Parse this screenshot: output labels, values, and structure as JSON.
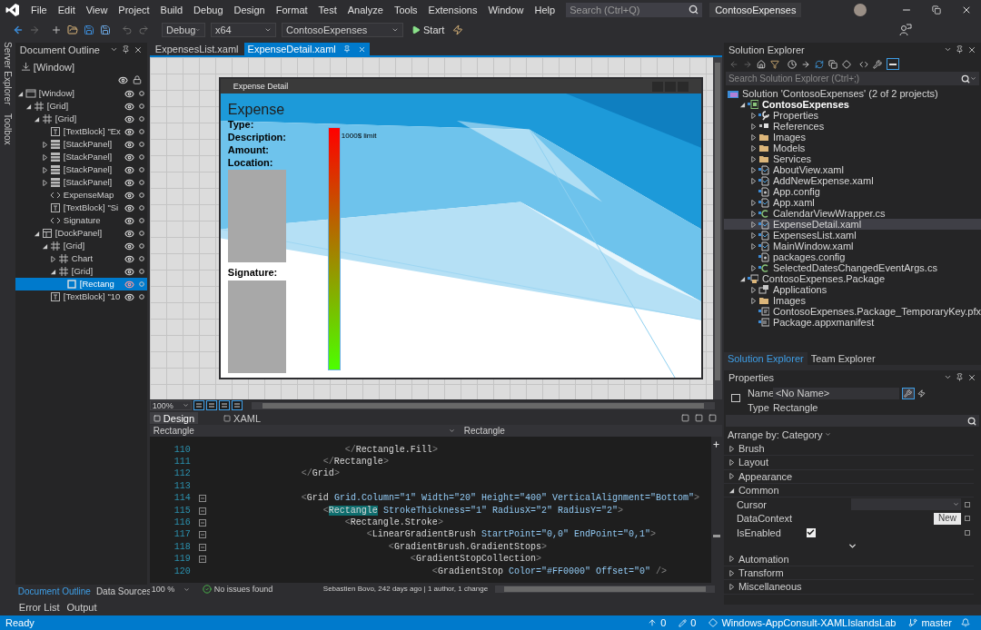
{
  "title_bar": {
    "menu": [
      "File",
      "Edit",
      "View",
      "Project",
      "Build",
      "Debug",
      "Design",
      "Format",
      "Test",
      "Analyze",
      "Tools",
      "Extensions",
      "Window",
      "Help"
    ],
    "search": {
      "placeholder": "Search (Ctrl+Q)"
    },
    "title": "ContosoExpenses"
  },
  "toolbar": {
    "configuration": "Debug",
    "platform": "x64",
    "project": "ContosoExpenses",
    "start": "Start"
  },
  "side_tabs": [
    "Server Explorer",
    "Toolbox"
  ],
  "document_outline": {
    "title": "Document Outline",
    "top": "[Window]",
    "items": [
      {
        "label": "[Window]",
        "kind": "window",
        "expanded": true,
        "selected": false,
        "children": [
          {
            "label": "[Grid]",
            "kind": "grid",
            "expanded": true,
            "selected": false,
            "children": [
              {
                "label": "[Grid]",
                "kind": "grid",
                "expanded": true,
                "selected": false,
                "children": [
                  {
                    "label": "[TextBlock] \"Ex",
                    "kind": "textblock",
                    "selected": false
                  },
                  {
                    "label": "[StackPanel]",
                    "kind": "stackpanel",
                    "expanded": false,
                    "selected": false
                  },
                  {
                    "label": "[StackPanel]",
                    "kind": "stackpanel",
                    "expanded": false,
                    "selected": false
                  },
                  {
                    "label": "[StackPanel]",
                    "kind": "stackpanel",
                    "expanded": false,
                    "selected": false
                  },
                  {
                    "label": "[StackPanel]",
                    "kind": "stackpanel",
                    "expanded": false,
                    "selected": false
                  },
                  {
                    "label": "ExpenseMap",
                    "kind": "control",
                    "selected": false
                  },
                  {
                    "label": "[TextBlock] \"Si",
                    "kind": "textblock",
                    "selected": false
                  },
                  {
                    "label": "Signature",
                    "kind": "control",
                    "selected": false
                  }
                ]
              },
              {
                "label": "[DockPanel]",
                "kind": "dockpanel",
                "expanded": true,
                "selected": false,
                "children": [
                  {
                    "label": "[Grid]",
                    "kind": "grid",
                    "expanded": true,
                    "selected": false,
                    "children": [
                      {
                        "label": "Chart",
                        "kind": "grid",
                        "expanded": false,
                        "selected": false
                      },
                      {
                        "label": "[Grid]",
                        "kind": "grid",
                        "expanded": true,
                        "selected": false,
                        "children": [
                          {
                            "label": "[Rectang",
                            "kind": "rectangle",
                            "selected": true
                          }
                        ]
                      }
                    ]
                  },
                  {
                    "label": "[TextBlock] \"10",
                    "kind": "textblock",
                    "selected": false
                  }
                ]
              }
            ]
          }
        ]
      }
    ]
  },
  "left_bottom_tabs": [
    {
      "label": "Document Outline",
      "selected": true
    },
    {
      "label": "Data Sources",
      "selected": false
    }
  ],
  "output_tabs": [
    "Error List",
    "Output"
  ],
  "editor_tabs": [
    {
      "label": "ExpensesList.xaml",
      "selected": false
    },
    {
      "label": "ExpenseDetail.xaml",
      "selected": true
    }
  ],
  "designer": {
    "window_title": "Expense Detail",
    "heading": "Expense",
    "labels": [
      "Type:",
      "Description:",
      "Amount:",
      "Location:"
    ],
    "signature_label": "Signature:",
    "limit_label": "1000$ limit",
    "zoom": "100%"
  },
  "view_tabs": [
    {
      "label": "Design",
      "selected": true
    },
    {
      "label": "XAML",
      "selected": false
    }
  ],
  "nav_bar": {
    "left": "Rectangle",
    "right": "Rectangle"
  },
  "code": {
    "lines": [
      {
        "number": "110",
        "foldable": false,
        "tokens": [
          {
            "text": "                        </",
            "kind": "punct"
          },
          {
            "text": "Rectangle.Fill",
            "kind": "element"
          },
          {
            "text": ">",
            "kind": "punct"
          }
        ]
      },
      {
        "number": "111",
        "foldable": false,
        "tokens": [
          {
            "text": "                    </",
            "kind": "punct"
          },
          {
            "text": "Rectangle",
            "kind": "element"
          },
          {
            "text": ">",
            "kind": "punct"
          }
        ]
      },
      {
        "number": "112",
        "foldable": false,
        "tokens": [
          {
            "text": "                </",
            "kind": "punct"
          },
          {
            "text": "Grid",
            "kind": "element"
          },
          {
            "text": ">",
            "kind": "punct"
          }
        ]
      },
      {
        "number": "113",
        "foldable": false
      },
      {
        "number": "114",
        "foldable": true,
        "tokens": [
          {
            "text": "                <",
            "kind": "punct"
          },
          {
            "text": "Grid",
            "kind": "element"
          },
          {
            "text": " Grid.Column=",
            "kind": "attr"
          },
          {
            "text": "\"1\"",
            "kind": "value"
          },
          {
            "text": " Width=",
            "kind": "attr"
          },
          {
            "text": "\"20\"",
            "kind": "value"
          },
          {
            "text": " Height=",
            "kind": "attr"
          },
          {
            "text": "\"400\"",
            "kind": "value"
          },
          {
            "text": " VerticalAlignment=",
            "kind": "attr"
          },
          {
            "text": "\"Bottom\"",
            "kind": "value"
          },
          {
            "text": ">",
            "kind": "punct"
          }
        ]
      },
      {
        "number": "115",
        "foldable": true,
        "tokens": [
          {
            "text": "                    <",
            "kind": "punct"
          },
          {
            "text": "Rectangle",
            "kind": "match"
          },
          {
            "text": " StrokeThickness=",
            "kind": "attr"
          },
          {
            "text": "\"1\"",
            "kind": "value"
          },
          {
            "text": " RadiusX=",
            "kind": "attr"
          },
          {
            "text": "\"2\"",
            "kind": "value"
          },
          {
            "text": " RadiusY=",
            "kind": "attr"
          },
          {
            "text": "\"2\"",
            "kind": "value"
          },
          {
            "text": ">",
            "kind": "punct"
          }
        ]
      },
      {
        "number": "116",
        "foldable": true,
        "tokens": [
          {
            "text": "                        <",
            "kind": "punct"
          },
          {
            "text": "Rectangle.Stroke",
            "kind": "element"
          },
          {
            "text": ">",
            "kind": "punct"
          }
        ]
      },
      {
        "number": "117",
        "foldable": true,
        "tokens": [
          {
            "text": "                            <",
            "kind": "punct"
          },
          {
            "text": "LinearGradientBrush",
            "kind": "element"
          },
          {
            "text": " StartPoint=",
            "kind": "attr"
          },
          {
            "text": "\"0,0\"",
            "kind": "value"
          },
          {
            "text": " EndPoint=",
            "kind": "attr"
          },
          {
            "text": "\"0,1\"",
            "kind": "value"
          },
          {
            "text": ">",
            "kind": "punct"
          }
        ]
      },
      {
        "number": "118",
        "foldable": true,
        "tokens": [
          {
            "text": "                                <",
            "kind": "punct"
          },
          {
            "text": "GradientBrush.GradientStops",
            "kind": "element"
          },
          {
            "text": ">",
            "kind": "punct"
          }
        ]
      },
      {
        "number": "119",
        "foldable": true,
        "tokens": [
          {
            "text": "                                    <",
            "kind": "punct"
          },
          {
            "text": "GradientStopCollection",
            "kind": "element"
          },
          {
            "text": ">",
            "kind": "punct"
          }
        ]
      },
      {
        "number": "120",
        "foldable": false,
        "tokens": [
          {
            "text": "                                        <",
            "kind": "punct"
          },
          {
            "text": "GradientStop",
            "kind": "element"
          },
          {
            "text": " Color=",
            "kind": "attr"
          },
          {
            "text": "\"#FF0000\"",
            "kind": "value"
          },
          {
            "text": " Offset=",
            "kind": "attr"
          },
          {
            "text": "\"0\"",
            "kind": "value"
          },
          {
            "text": " />",
            "kind": "punct"
          }
        ]
      }
    ]
  },
  "editor_status": {
    "zoom": "100 %",
    "issues": "No issues found",
    "blame": "Sebastien Bovo, 242 days ago | 1 author, 1 change"
  },
  "solution_explorer": {
    "title": "Solution Explorer",
    "search": {
      "placeholder": "Search Solution Explorer (Ctrl+;)"
    },
    "items": [
      {
        "label": "Solution 'ContosoExpenses' (2 of 2 projects)",
        "kind": "solution",
        "selected": false,
        "children": [
          {
            "label": "ContosoExpenses",
            "kind": "project",
            "expanded": true,
            "selected": false,
            "children": [
              {
                "label": "Properties",
                "kind": "properties",
                "expanded": false,
                "selected": false
              },
              {
                "label": "References",
                "kind": "references",
                "expanded": false,
                "selected": false
              },
              {
                "label": "Images",
                "kind": "folder",
                "expanded": false,
                "selected": false
              },
              {
                "label": "Models",
                "kind": "folder",
                "expanded": false,
                "selected": false
              },
              {
                "label": "Services",
                "kind": "folder",
                "expanded": false,
                "selected": false
              },
              {
                "label": "AboutView.xaml",
                "kind": "xaml",
                "expanded": false,
                "selected": false
              },
              {
                "label": "AddNewExpense.xaml",
                "kind": "xaml",
                "expanded": false,
                "selected": false
              },
              {
                "label": "App.config",
                "kind": "config",
                "selected": false
              },
              {
                "label": "App.xaml",
                "kind": "xaml",
                "expanded": false,
                "selected": false
              },
              {
                "label": "CalendarViewWrapper.cs",
                "kind": "cs",
                "expanded": false,
                "selected": false
              },
              {
                "label": "ExpenseDetail.xaml",
                "kind": "xaml",
                "expanded": false,
                "selected": true
              },
              {
                "label": "ExpensesList.xaml",
                "kind": "xaml",
                "expanded": false,
                "selected": false
              },
              {
                "label": "MainWindow.xaml",
                "kind": "xaml",
                "expanded": false,
                "selected": false
              },
              {
                "label": "packages.config",
                "kind": "config",
                "selected": false
              },
              {
                "label": "SelectedDatesChangedEventArgs.cs",
                "kind": "cs",
                "expanded": false,
                "selected": false
              }
            ]
          },
          {
            "label": "ContosoExpenses.Package",
            "kind": "package",
            "expanded": true,
            "selected": false,
            "children": [
              {
                "label": "Applications",
                "kind": "applications",
                "expanded": false,
                "selected": false
              },
              {
                "label": "Images",
                "kind": "folder",
                "expanded": false,
                "selected": false
              },
              {
                "label": "ContosoExpenses.Package_TemporaryKey.pfx",
                "kind": "pfx",
                "selected": false
              },
              {
                "label": "Package.appxmanifest",
                "kind": "manifest",
                "selected": false
              }
            ]
          }
        ]
      }
    ]
  },
  "right_tabs": [
    {
      "label": "Solution Explorer",
      "selected": true
    },
    {
      "label": "Team Explorer",
      "selected": false
    }
  ],
  "properties": {
    "title": "Properties",
    "name_label": "Name",
    "name_value": "<No Name>",
    "type_label": "Type",
    "type_value": "Rectangle",
    "arrange": "Arrange by: Category",
    "categories": [
      {
        "label": "Brush",
        "expanded": false
      },
      {
        "label": "Layout",
        "expanded": false
      },
      {
        "label": "Appearance",
        "expanded": false
      },
      {
        "label": "Common",
        "expanded": true,
        "properties": [
          {
            "label": "Cursor",
            "kind": "dropdown"
          },
          {
            "label": "DataContext",
            "kind": "button",
            "button": "New"
          },
          {
            "label": "IsEnabled",
            "kind": "checkbox",
            "checked": true
          }
        ]
      },
      {
        "label": "Automation",
        "expanded": false
      },
      {
        "label": "Transform",
        "expanded": false
      },
      {
        "label": "Miscellaneous",
        "expanded": false
      }
    ]
  },
  "status_bar": {
    "state": "Ready",
    "pushes": "0",
    "changes": "0",
    "repository": "Windows-AppConsult-XAMLIslandsLab",
    "branch": "master"
  }
}
